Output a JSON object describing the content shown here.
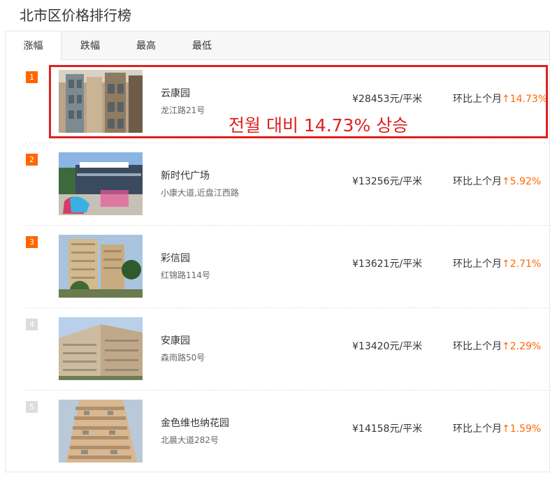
{
  "page": {
    "title": "北市区价格排行榜"
  },
  "tabs": [
    {
      "label": "涨幅",
      "active": true
    },
    {
      "label": "跌幅",
      "active": false
    },
    {
      "label": "最高",
      "active": false
    },
    {
      "label": "最低",
      "active": false
    }
  ],
  "items": [
    {
      "rank": "1",
      "name": "云康园",
      "address": "龙江路21号",
      "price": "¥28453元/平米",
      "change_label": "环比上个月",
      "arrow": "↑",
      "change": "14.73%"
    },
    {
      "rank": "2",
      "name": "新时代广场",
      "address": "小康大道,近盘江西路",
      "price": "¥13256元/平米",
      "change_label": "环比上个月",
      "arrow": "↑",
      "change": "5.92%"
    },
    {
      "rank": "3",
      "name": "彩信园",
      "address": "红锦路114号",
      "price": "¥13621元/平米",
      "change_label": "环比上个月",
      "arrow": "↑",
      "change": "2.71%"
    },
    {
      "rank": "4",
      "name": "安康园",
      "address": "森雨路50号",
      "price": "¥13420元/平米",
      "change_label": "环比上个月",
      "arrow": "↑",
      "change": "2.29%"
    },
    {
      "rank": "5",
      "name": "金色维也纳花园",
      "address": "北晨大道282号",
      "price": "¥14158元/平米",
      "change_label": "环比上个月",
      "arrow": "↑",
      "change": "1.59%"
    }
  ],
  "annotation": {
    "text": "전월 대비  14.73% 상승"
  },
  "colors": {
    "accent": "#ff6600",
    "highlight": "#e02020",
    "rank_inactive": "#dddddd"
  }
}
